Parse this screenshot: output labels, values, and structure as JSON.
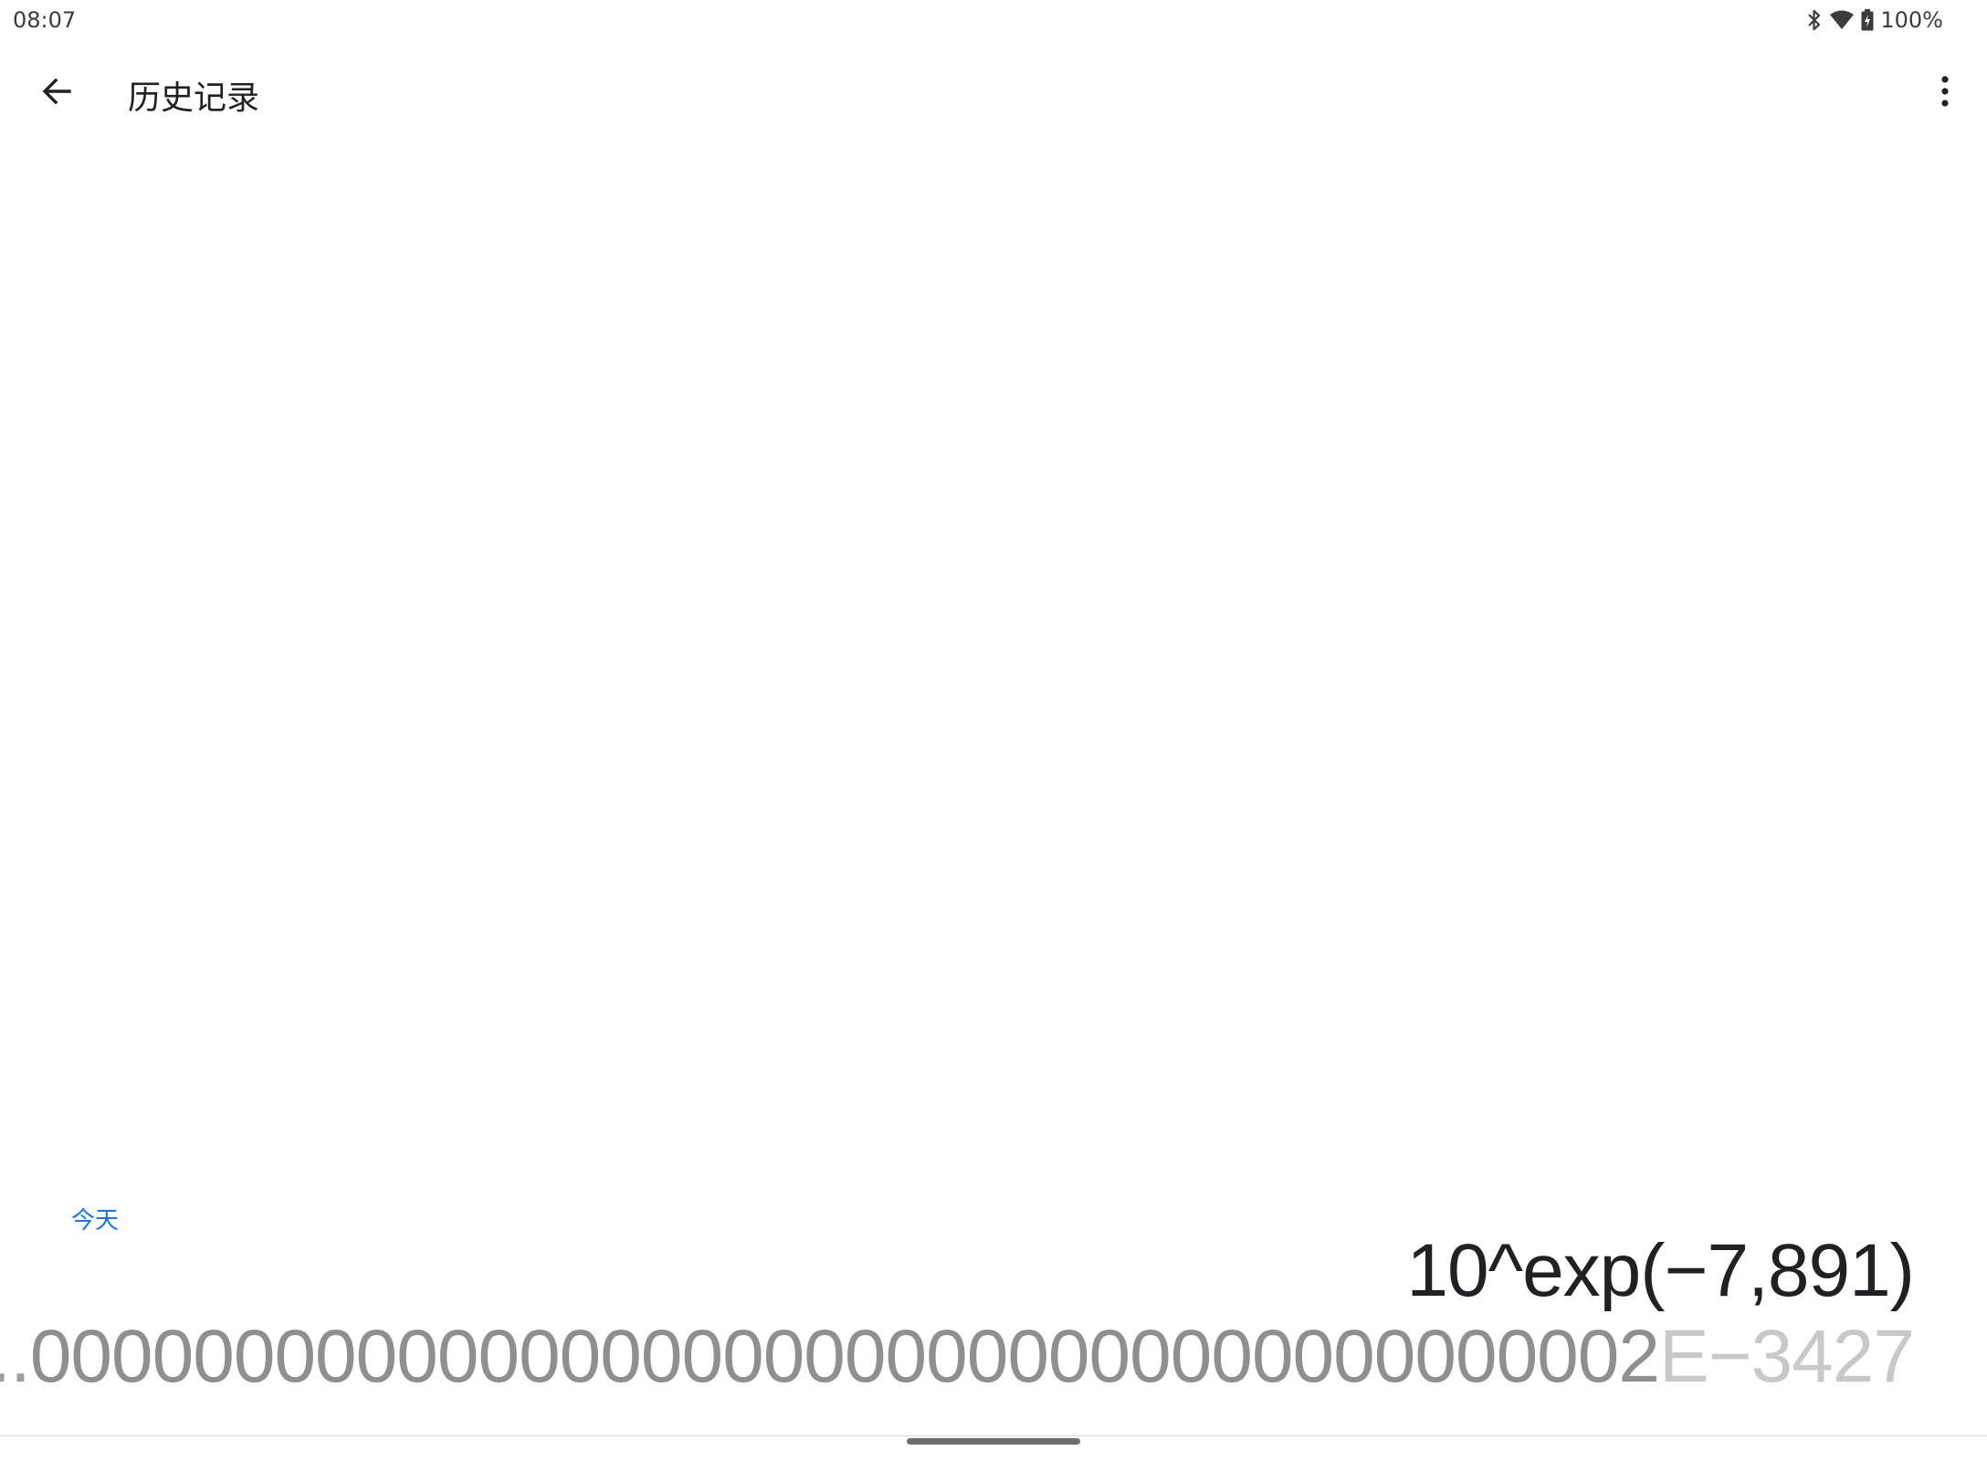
{
  "status_bar": {
    "time": "08:07",
    "battery_text": "100%",
    "icons": [
      "bluetooth-icon",
      "wifi-icon",
      "battery-icon"
    ]
  },
  "toolbar": {
    "back_icon": "arrow-back-icon",
    "title": "历史记录",
    "more_icon": "more-vert-icon"
  },
  "history": {
    "section_label": "今天",
    "entries": [
      {
        "expression": "10^exp(−7,891)",
        "result_ellipsis": "...",
        "result_mantissa": "0000000000000000000000000000000000000002",
        "result_exponent": "E−3427"
      }
    ]
  },
  "colors": {
    "accent": "#1a73e8",
    "text_primary": "#202124",
    "result_gray": "#8f8f8f",
    "exponent_gray": "#c8c8c8"
  }
}
